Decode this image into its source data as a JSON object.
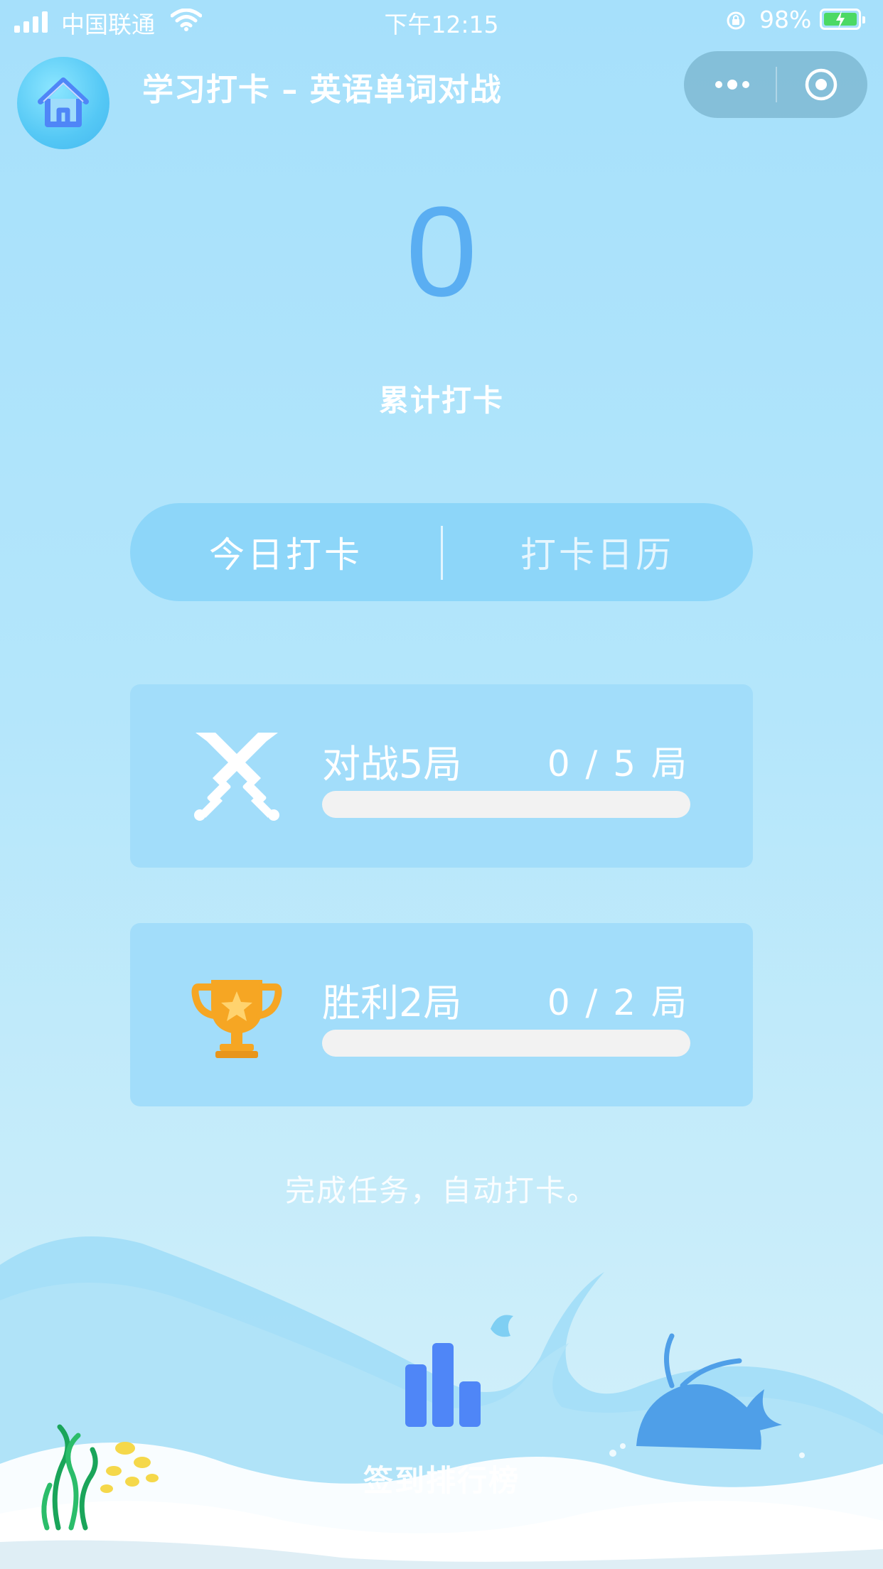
{
  "status_bar": {
    "carrier": "中国联通",
    "time": "下午12:15",
    "battery": "98%"
  },
  "nav": {
    "title": "学习打卡 – 英语单词对战"
  },
  "summary": {
    "count": "0",
    "label": "累计打卡"
  },
  "tabs": [
    {
      "label": "今日打卡"
    },
    {
      "label": "打卡日历"
    }
  ],
  "tasks": [
    {
      "name": "对战5局",
      "progress_text": "0 / 5 局",
      "icon": "crossed-swords-icon",
      "done": 0,
      "total": 5
    },
    {
      "name": "胜利2局",
      "progress_text": "0 / 2 局",
      "icon": "trophy-icon",
      "done": 0,
      "total": 2
    }
  ],
  "hint": "完成任务，自动打卡。",
  "leaderboard": {
    "label": "签到排行榜",
    "icon": "bar-chart-icon"
  },
  "colors": {
    "accent": "#5aaef2",
    "trophy": "#f6a623",
    "bars": "#4f86f7"
  }
}
